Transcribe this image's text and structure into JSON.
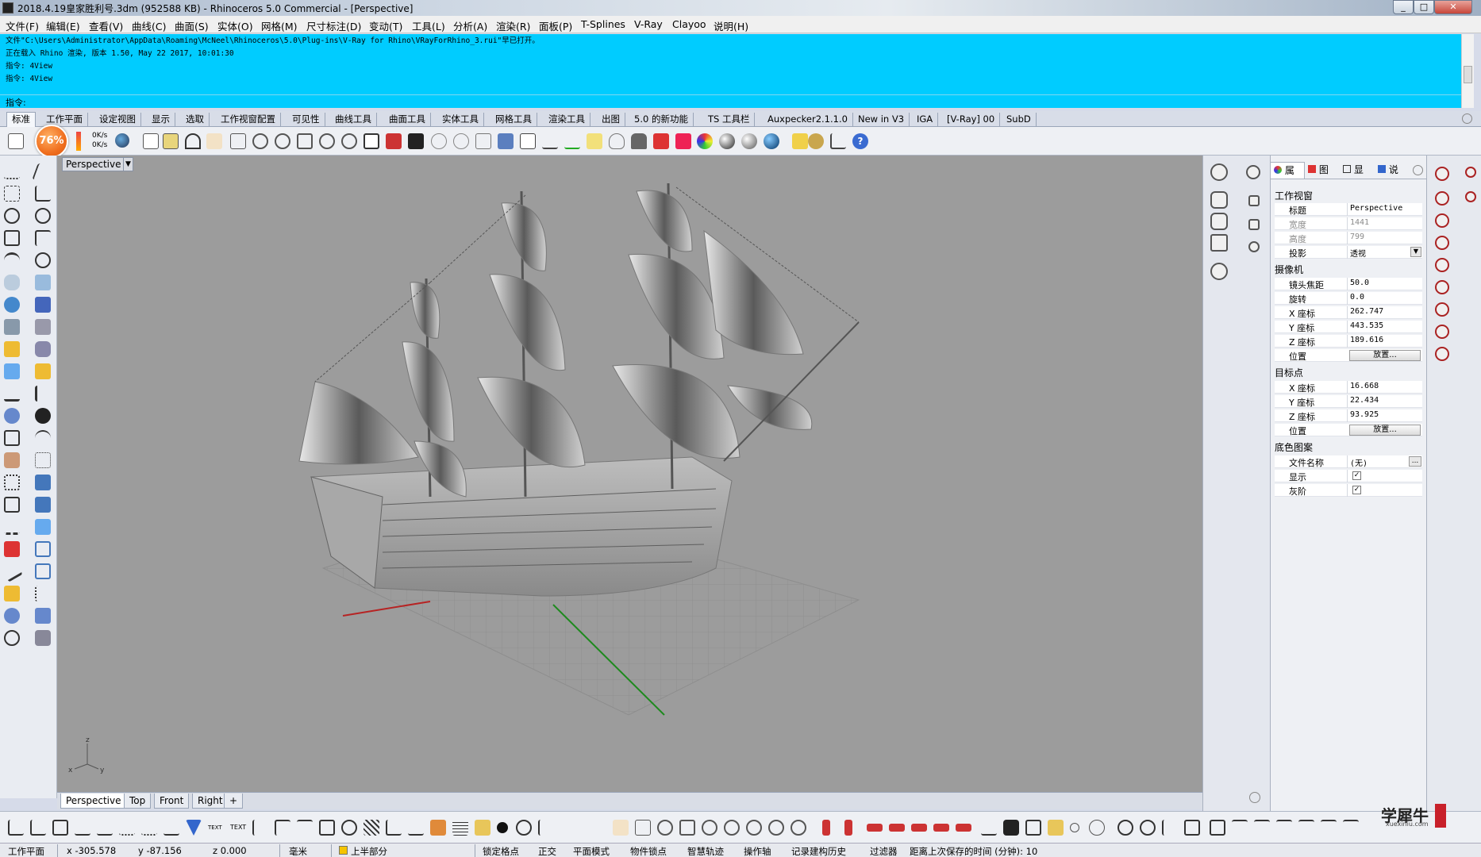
{
  "title": "2018.4.19皇家胜利号.3dm (952588 KB) - Rhinoceros 5.0 Commercial - [Perspective]",
  "window_buttons": [
    "_",
    "□",
    "✕"
  ],
  "menu": [
    "文件(F)",
    "编辑(E)",
    "查看(V)",
    "曲线(C)",
    "曲面(S)",
    "实体(O)",
    "网格(M)",
    "尺寸标注(D)",
    "变动(T)",
    "工具(L)",
    "分析(A)",
    "渲染(R)",
    "面板(P)",
    "T-Splines",
    "V-Ray",
    "Clayoo",
    "说明(H)"
  ],
  "command_history": [
    "文件\"C:\\Users\\Administrator\\AppData\\Roaming\\McNeel\\Rhinoceros\\5.0\\Plug-ins\\V-Ray for Rhino\\VRayForRhino_3.rui\"早已打开。",
    "正在载入 Rhino 渲染, 版本 1.50, May 22 2017, 10:01:30",
    "指令: 4View",
    "指令: 4View"
  ],
  "command_prompt": "指令:",
  "toolbar_tabs": [
    "标准",
    "工作平面",
    "设定视图",
    "显示",
    "选取",
    "工作视窗配置",
    "可见性",
    "曲线工具",
    "曲面工具",
    "实体工具",
    "网格工具",
    "渲染工具",
    "出图",
    "5.0 的新功能",
    "TS 工具栏",
    "Auxpecker2.1.1.0",
    "New in V3",
    "IGA",
    "[V-Ray] 00",
    "SubD"
  ],
  "active_tab": "标准",
  "badge": {
    "percent": "76%"
  },
  "net_speed": {
    "up": "0K/s",
    "down": "0K/s"
  },
  "viewport": {
    "title": "Perspective",
    "dropdown": "▼"
  },
  "viewport_tabs": [
    "Perspective",
    "Top",
    "Front",
    "Right",
    "+"
  ],
  "active_viewport_tab": "Perspective",
  "axis_labels": {
    "z": "z",
    "x": "x",
    "y": "y"
  },
  "properties": {
    "tabs": [
      {
        "icon": "object-properties-icon",
        "label": "属"
      },
      {
        "icon": "layers-icon",
        "label": "图"
      },
      {
        "icon": "display-icon",
        "label": "显"
      },
      {
        "icon": "help-icon",
        "label": "说"
      }
    ],
    "sections": {
      "viewport": "工作视窗",
      "camera": "摄像机",
      "target": "目标点",
      "wallpaper": "底色图案"
    },
    "viewport_rows": [
      {
        "k": "标题",
        "v": "Perspective"
      },
      {
        "k": "宽度",
        "v": "1441",
        "disabled": true
      },
      {
        "k": "高度",
        "v": "799",
        "disabled": true
      },
      {
        "k": "投影",
        "v": "透视",
        "dropdown": true
      }
    ],
    "camera_rows": [
      {
        "k": "镜头焦距",
        "v": "50.0"
      },
      {
        "k": "旋转",
        "v": "0.0"
      },
      {
        "k": "X 座标",
        "v": "262.747"
      },
      {
        "k": "Y 座标",
        "v": "443.535"
      },
      {
        "k": "Z 座标",
        "v": "189.616"
      },
      {
        "k": "位置",
        "button": "放置..."
      }
    ],
    "target_rows": [
      {
        "k": "X 座标",
        "v": "16.668"
      },
      {
        "k": "Y 座标",
        "v": "22.434"
      },
      {
        "k": "Z 座标",
        "v": "93.925"
      },
      {
        "k": "位置",
        "button": "放置..."
      }
    ],
    "wallpaper_rows": [
      {
        "k": "文件名称",
        "v": "(无)",
        "browse": "..."
      },
      {
        "k": "显示",
        "checked": true
      },
      {
        "k": "灰阶",
        "checked": true
      }
    ]
  },
  "status_bar": {
    "cplane": "工作平面",
    "x": "x -305.578",
    "y": "y -87.156",
    "z": "z 0.000",
    "units": "毫米",
    "layer": "上半部分",
    "toggles": [
      "锁定格点",
      "正交",
      "平面模式",
      "物件锁点",
      "智慧轨迹",
      "操作轴",
      "记录建构历史",
      "过滤器"
    ],
    "autosave": "距离上次保存的时间 (分钟): 10"
  },
  "watermark": {
    "name": "学犀牛",
    "site": "xuexiniu.com",
    "seal": "犀牛"
  },
  "colors": {
    "command_bg": "#00ccff",
    "viewport_bg": "#9c9c9c",
    "badge": "#f07a28"
  }
}
